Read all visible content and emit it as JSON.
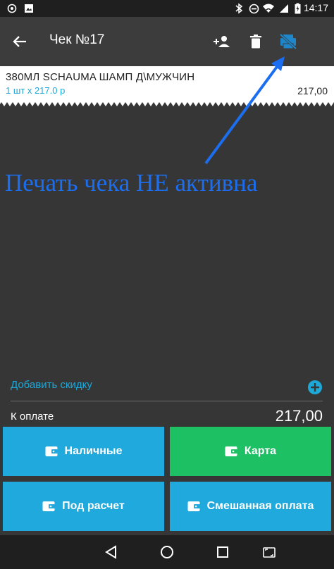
{
  "status_bar": {
    "time": "14:17",
    "icons": [
      "notification-icon",
      "image-icon",
      "bluetooth-icon",
      "do-not-disturb-icon",
      "wifi-icon",
      "signal-icon",
      "battery-charging-icon"
    ]
  },
  "app_bar": {
    "title": "Чек №17",
    "actions": [
      "back-arrow-icon",
      "add-customer-icon",
      "delete-icon",
      "print-disabled-icon"
    ]
  },
  "receipt": {
    "items": [
      {
        "name": "380МЛ SCHAUMA ШАМП Д\\МУЖЧИН",
        "qty_price": "1 шт x 217.0 р",
        "sum": "217,00"
      }
    ]
  },
  "annotation": {
    "text": "Печать чека НЕ активна",
    "color": "#1c6ef0"
  },
  "summary": {
    "discount_label": "Добавить скидку",
    "to_pay_label": "К оплате",
    "to_pay_value": "217,00"
  },
  "payment_buttons": {
    "cash": {
      "label": "Наличные",
      "color": "#1fa9dc"
    },
    "card": {
      "label": "Карта",
      "color": "#1ec064"
    },
    "credit": {
      "label": "Под расчет",
      "color": "#1fa9dc"
    },
    "mixed": {
      "label": "Смешанная оплата",
      "color": "#1fa9dc"
    }
  },
  "nav_bar": {
    "icons": [
      "back-triangle-icon",
      "home-circle-icon",
      "recents-square-icon",
      "screenshot-icon"
    ]
  }
}
